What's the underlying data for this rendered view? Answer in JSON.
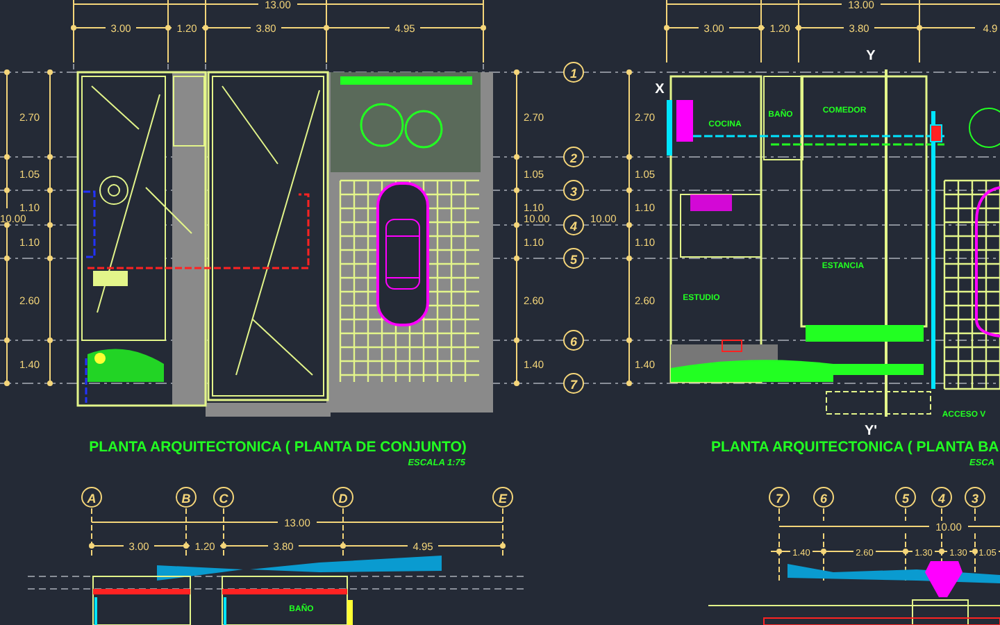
{
  "plan_left": {
    "overall": "13.00",
    "spans": [
      "3.00",
      "1.20",
      "3.80",
      "4.95"
    ],
    "title": "PLANTA ARQUITECTONICA ( PLANTA DE CONJUNTO)",
    "scale": "ESCALA 1:75"
  },
  "axis_column": {
    "bubbles": [
      "1",
      "2",
      "3",
      "4",
      "5",
      "6",
      "7"
    ],
    "outer_dims": [
      "2.70",
      "1.05",
      "1.10",
      "10.00",
      "1.10",
      "2.60",
      "1.40"
    ],
    "inner_left_dims": [
      "2.70",
      "1.05",
      "1.10",
      "10.00",
      "1.10",
      "2.60",
      "1.40"
    ],
    "inner_right_dims": [
      "2.70",
      "1.05",
      "1.10",
      "10.00",
      "1.10",
      "2.60",
      "1.40"
    ]
  },
  "plan_right": {
    "overall": "13.00",
    "spans": [
      "3.00",
      "1.20",
      "3.80",
      "4.9"
    ],
    "markers": [
      "X",
      "Y",
      "Y'"
    ],
    "rooms": [
      "COCINA",
      "BAÑO",
      "COMEDOR",
      "ESTANCIA",
      "ESTUDIO",
      "ACCESO V"
    ],
    "title": "PLANTA ARQUITECTONICA ( PLANTA BA",
    "scale": "ESCA"
  },
  "section_left": {
    "bubbles": [
      "A",
      "B",
      "C",
      "D",
      "E"
    ],
    "overall": "13.00",
    "spans": [
      "3.00",
      "1.20",
      "3.80",
      "4.95"
    ],
    "room": "BAÑO"
  },
  "section_right": {
    "bubbles": [
      "7",
      "6",
      "5",
      "4",
      "3"
    ],
    "overall": "10.00",
    "spans": [
      "1.40",
      "2.60",
      "1.30",
      "1.30",
      "1.05"
    ]
  }
}
